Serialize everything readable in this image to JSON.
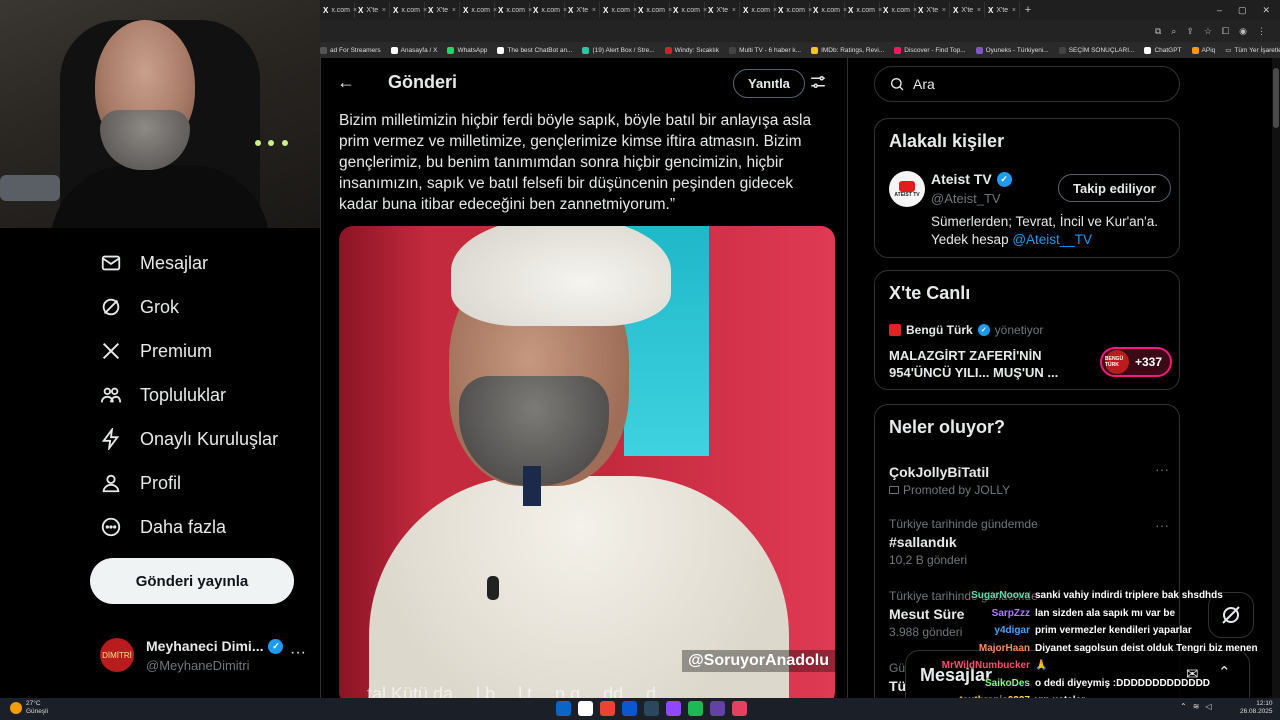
{
  "browser": {
    "tabs": [
      {
        "label": "x.com"
      },
      {
        "label": "X'te"
      },
      {
        "label": "x.com"
      },
      {
        "label": "X'te"
      },
      {
        "label": "x.com"
      },
      {
        "label": "x.com"
      },
      {
        "label": "x.com"
      },
      {
        "label": "X'te"
      },
      {
        "label": "x.com"
      },
      {
        "label": "x.com"
      },
      {
        "label": "x.com"
      },
      {
        "label": "X'te"
      },
      {
        "label": "x.com"
      },
      {
        "label": "x.com"
      },
      {
        "label": "x.com"
      },
      {
        "label": "x.com"
      },
      {
        "label": "x.com"
      },
      {
        "label": "X'te"
      },
      {
        "label": "X'te"
      },
      {
        "label": "X'te"
      }
    ],
    "new_tab": "+",
    "bookmarks": [
      {
        "label": "ad For Streamers",
        "color": "#555555"
      },
      {
        "label": "Anasayfa / X",
        "color": "#ffffff"
      },
      {
        "label": "WhatsApp",
        "color": "#25d366"
      },
      {
        "label": "The best ChatBot an...",
        "color": "#ffffff"
      },
      {
        "label": "(19) Alert Box / Stre...",
        "color": "#31c3a2"
      },
      {
        "label": "Windy: Sıcaklık",
        "color": "#c62828"
      },
      {
        "label": "Multi TV - 6 haber k...",
        "color": "#444444"
      },
      {
        "label": "IMDb: Ratings, Revi...",
        "color": "#f5c518"
      },
      {
        "label": "Discover - Find Top...",
        "color": "#e91e63"
      },
      {
        "label": "Oyuneks - Türkiyeni...",
        "color": "#7e57c2"
      },
      {
        "label": "SEÇİM SONUÇLARI...",
        "color": "#444444"
      },
      {
        "label": "ChatGPT",
        "color": "#ffffff"
      },
      {
        "label": "APiq",
        "color": "#ff9800"
      }
    ],
    "bookmarks_right": "Tüm Yer İşaretleri"
  },
  "sidebar": {
    "items": [
      {
        "label": "Mesajlar",
        "icon": "envelope-icon"
      },
      {
        "label": "Grok",
        "icon": "grok-icon"
      },
      {
        "label": "Premium",
        "icon": "x-logo-icon"
      },
      {
        "label": "Topluluklar",
        "icon": "people-icon"
      },
      {
        "label": "Onaylı Kuruluşlar",
        "icon": "lightning-icon"
      },
      {
        "label": "Profil",
        "icon": "person-icon"
      },
      {
        "label": "Daha fazla",
        "icon": "more-circle-icon"
      }
    ],
    "post_button": "Gönderi yayınla",
    "profile": {
      "name": "Meyhaneci Dimi...",
      "handle": "@MeyhaneDimitri",
      "avatar_text": "DİMİTRİ",
      "more": "···"
    }
  },
  "main": {
    "title": "Gönderi",
    "reply_button": "Yanıtla",
    "post_text": "Bizim milletimizin hiçbir ferdi böyle sapık, böyle batıl bir anlayışa asla prim vermez ve milletimize, gençlerimize kimse iftira atmasın. Bizim gençlerimiz, bu benim tanımımdan sonra hiçbir gencimizin, hiçbir insanımızın, sapık ve batıl felsefi bir düşüncenin peşinden gidecek kadar buna itibar edeceğini ben zannetmiyorum.”",
    "media": {
      "watermark": "@SoruyorAnadolu",
      "caption": "…tal Kütü da …l b …l t …n g …dd …d …"
    }
  },
  "right": {
    "search_placeholder": "Ara",
    "related": {
      "title": "Alakalı kişiler",
      "name": "Ateist TV",
      "handle": "@Ateist_TV",
      "follow_button": "Takip ediliyor",
      "bio": "Sümerlerden; Tevrat, İncil ve Kur'an'a. Yedek hesap ",
      "bio_link": "@Ateist__TV",
      "avatar_text": "ATEIST TV"
    },
    "live": {
      "title": "X'te Canlı",
      "host": "Bengü Türk",
      "role": "yönetiyor",
      "headline": "MALAZGİRT ZAFERİ'NİN 954'ÜNCÜ YILI... MUŞ'UN ...",
      "pill_avatar": "BENGÜ TÜRK",
      "count": "+337"
    },
    "trends": {
      "title": "Neler oluyor?",
      "items": [
        {
          "context": "",
          "name": "ÇokJollyBiTatil",
          "count": "Promoted by JOLLY",
          "promoted": true
        },
        {
          "context": "Türkiye tarihinde gündemde",
          "name": "#sallandık",
          "count": "10,2 B gönderi",
          "promoted": false
        },
        {
          "context": "Türkiye tarihinde gündemde",
          "name": "Mesut Süre",
          "count": "3.988 gönderi",
          "promoted": false
        },
        {
          "context": "Gü",
          "name": "Tü",
          "count": "",
          "promoted": false
        }
      ],
      "more": "···"
    }
  },
  "messages_drawer": {
    "title": "Mesajlar"
  },
  "chat": [
    {
      "user": "SugarNoova",
      "msg": "sanki vahiy indirdi triplere bak shsdhds",
      "color": "#5ee0b0"
    },
    {
      "user": "SarpZzz",
      "msg": "lan sizden ala sapık mı var be",
      "color": "#b07cff"
    },
    {
      "user": "y4digar",
      "msg": "prim vermezler kendileri yaparlar",
      "color": "#4aa3ff"
    },
    {
      "user": "MajorHaan",
      "msg": "Diyanet sagolsun deist olduk Tengri biz menen",
      "color": "#ff8c5a"
    },
    {
      "user": "MrWildNumbucker",
      "msg": "🙏",
      "color": "#ff4d6d"
    },
    {
      "user": "SaikoDes",
      "msg": "o dedi diyeymiş :DDDDDDDDDDDDD",
      "color": "#7fff7f"
    },
    {
      "user": "teuthrania0227",
      "msg": "vıp ustalar",
      "color": "#ffd84d"
    }
  ],
  "taskbar": {
    "temp": "27°C",
    "weather": "Güneşli",
    "time": "12:10",
    "date": "26.08.2025",
    "apps": [
      "#0a66c2",
      "#ffffff",
      "#ea4335",
      "#0b57d0",
      "#2a475e",
      "#9146ff",
      "#1db954",
      "#6441a5",
      "#e4405f"
    ]
  }
}
